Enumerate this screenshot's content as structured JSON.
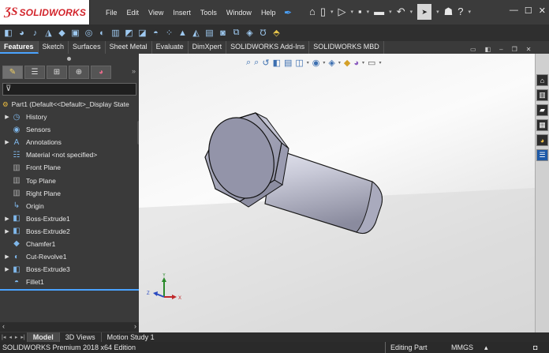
{
  "app": {
    "logo_mark": "ƷS",
    "logo_text": "SOLIDWORKS"
  },
  "menu": [
    "File",
    "Edit",
    "View",
    "Insert",
    "Tools",
    "Window",
    "Help"
  ],
  "quick_access": [
    "home-icon",
    "new-document-icon",
    "open-icon",
    "save-icon",
    "print-icon",
    "undo-icon",
    "select-icon",
    "user-icon",
    "help-icon"
  ],
  "window_controls": [
    "minimize-icon",
    "maximize-icon",
    "close-icon"
  ],
  "command_icons": [
    "extruded-boss-icon",
    "revolved-boss-icon",
    "swept-boss-icon",
    "lofted-boss-icon",
    "boundary-boss-icon",
    "extruded-cut-icon",
    "hole-wizard-icon",
    "revolved-cut-icon",
    "swept-cut-icon",
    "lofted-cut-icon",
    "boundary-cut-icon",
    "fillet-icon",
    "linear-pattern-icon",
    "rib-icon",
    "draft-icon",
    "shell-icon",
    "wrap-icon",
    "intersect-icon",
    "reference-geometry-icon",
    "curves-icon",
    "instant3d-icon"
  ],
  "tabs": [
    "Features",
    "Sketch",
    "Surfaces",
    "Sheet Metal",
    "Evaluate",
    "DimXpert",
    "SOLIDWORKS Add-Ins",
    "SOLIDWORKS MBD"
  ],
  "active_tab": "Features",
  "feature_manager": {
    "root": "Part1  (Default<<Default>_Display State",
    "items": [
      {
        "label": "History",
        "expandable": true,
        "icon": "history-icon"
      },
      {
        "label": "Sensors",
        "expandable": false,
        "icon": "sensors-icon"
      },
      {
        "label": "Annotations",
        "expandable": true,
        "icon": "annotations-icon"
      },
      {
        "label": "Material <not specified>",
        "expandable": false,
        "icon": "material-icon"
      },
      {
        "label": "Front Plane",
        "expandable": false,
        "icon": "plane-icon"
      },
      {
        "label": "Top Plane",
        "expandable": false,
        "icon": "plane-icon"
      },
      {
        "label": "Right Plane",
        "expandable": false,
        "icon": "plane-icon"
      },
      {
        "label": "Origin",
        "expandable": false,
        "icon": "origin-icon"
      },
      {
        "label": "Boss-Extrude1",
        "expandable": true,
        "icon": "extrude-feature-icon"
      },
      {
        "label": "Boss-Extrude2",
        "expandable": true,
        "icon": "extrude-feature-icon"
      },
      {
        "label": "Chamfer1",
        "expandable": false,
        "icon": "chamfer-feature-icon"
      },
      {
        "label": "Cut-Revolve1",
        "expandable": true,
        "icon": "revolve-feature-icon"
      },
      {
        "label": "Boss-Extrude3",
        "expandable": true,
        "icon": "extrude-feature-icon"
      },
      {
        "label": "Fillet1",
        "expandable": false,
        "icon": "fillet-feature-icon"
      }
    ]
  },
  "bottom_tabs": [
    "Model",
    "3D Views",
    "Motion Study 1"
  ],
  "status": {
    "edition": "SOLIDWORKS Premium 2018 x64 Edition",
    "mode": "Editing Part",
    "units": "MMGS"
  },
  "triad": {
    "x": "X",
    "y": "Y",
    "z": "Z"
  },
  "colors": {
    "accent": "#4aa3ff",
    "brand": "#d2232a",
    "bolt": "#c9cad8"
  }
}
